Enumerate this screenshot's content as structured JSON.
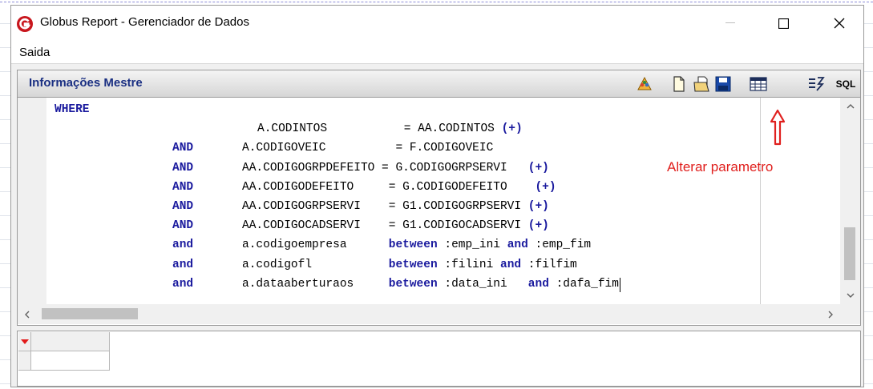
{
  "window": {
    "title": "Globus Report - Gerenciador de Dados",
    "controls": {
      "minimize": "—",
      "maximize": "☐",
      "close": "✕"
    }
  },
  "menu": {
    "items": [
      "Saida"
    ]
  },
  "panel": {
    "title": "Informações Mestre",
    "toolbar": [
      {
        "name": "people-icon"
      },
      {
        "name": "new-document-icon"
      },
      {
        "name": "open-document-icon"
      },
      {
        "name": "save-icon"
      },
      {
        "name": "grid-parameter-icon"
      },
      {
        "name": "edit-lines-icon"
      },
      {
        "name": "sql-icon",
        "label": "SQL"
      }
    ]
  },
  "editor": {
    "lines": [
      {
        "indent": 0,
        "tokens": [
          [
            "WHERE",
            true
          ]
        ]
      },
      {
        "indent": 1,
        "tokens": [
          [
            "A.CODINTOS           = AA.CODINTOS ",
            false
          ],
          [
            "(+)",
            true
          ]
        ]
      },
      {
        "indent": 2,
        "tokens": [
          [
            "AND",
            true
          ],
          [
            "       A.CODIGOVEIC          = F.CODIGOVEIC",
            false
          ]
        ]
      },
      {
        "indent": 2,
        "tokens": [
          [
            "AND",
            true
          ],
          [
            "       AA.CODIGOGRPDEFEITO = G.CODIGOGRPSERVI   ",
            false
          ],
          [
            "(+)",
            true
          ]
        ]
      },
      {
        "indent": 2,
        "tokens": [
          [
            "AND",
            true
          ],
          [
            "       AA.CODIGODEFEITO     = G.CODIGODEFEITO    ",
            false
          ],
          [
            "(+)",
            true
          ]
        ]
      },
      {
        "indent": 2,
        "tokens": [
          [
            "AND",
            true
          ],
          [
            "       AA.CODIGOGRPSERVI    = G1.CODIGOGRPSERVI ",
            false
          ],
          [
            "(+)",
            true
          ]
        ]
      },
      {
        "indent": 2,
        "tokens": [
          [
            "AND",
            true
          ],
          [
            "       AA.CODIGOCADSERVI    = G1.CODIGOCADSERVI ",
            false
          ],
          [
            "(+)",
            true
          ]
        ]
      },
      {
        "indent": 2,
        "tokens": [
          [
            "and",
            true
          ],
          [
            "       a.codigoempresa      ",
            false
          ],
          [
            "between",
            true
          ],
          [
            " :emp_ini ",
            false
          ],
          [
            "and",
            true
          ],
          [
            " :emp_fim",
            false
          ]
        ]
      },
      {
        "indent": 2,
        "tokens": [
          [
            "and",
            true
          ],
          [
            "       a.codigofl           ",
            false
          ],
          [
            "between",
            true
          ],
          [
            " :filini ",
            false
          ],
          [
            "and",
            true
          ],
          [
            " :filfim",
            false
          ]
        ]
      },
      {
        "indent": 2,
        "tokens": [
          [
            "and",
            true
          ],
          [
            "       a.dataaberturaos     ",
            false
          ],
          [
            "between",
            true
          ],
          [
            " :data_ini   ",
            false
          ],
          [
            "and",
            true
          ],
          [
            " :dafa_fim",
            false
          ]
        ]
      }
    ]
  },
  "annotation": {
    "text": "Alterar parametro",
    "color": "#e0201e"
  },
  "colors": {
    "keyword": "#1a1a9e",
    "panel_title": "#1a2f82",
    "logo": "#c8161d"
  }
}
